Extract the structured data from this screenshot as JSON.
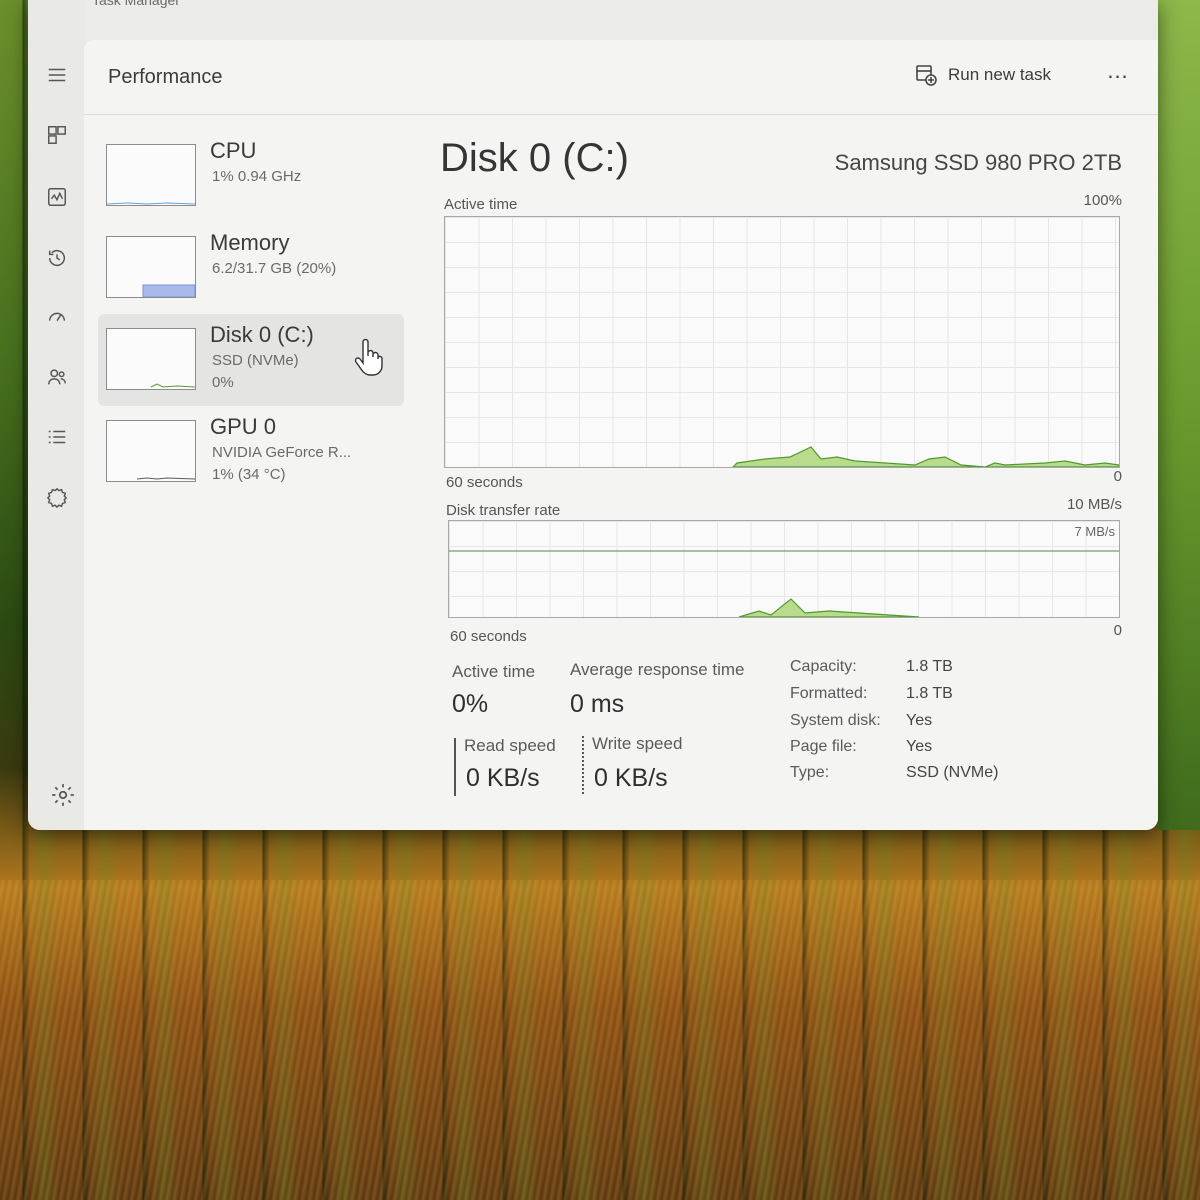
{
  "window": {
    "title": "Task Manager",
    "page_title": "Performance",
    "run_new_task": "Run new task",
    "more_options": "..."
  },
  "nav": {
    "items": [
      {
        "name": "menu-icon"
      },
      {
        "name": "processes-icon"
      },
      {
        "name": "performance-icon"
      },
      {
        "name": "app-history-icon"
      },
      {
        "name": "startup-apps-icon"
      },
      {
        "name": "users-icon"
      },
      {
        "name": "details-icon"
      },
      {
        "name": "services-icon"
      },
      {
        "name": "settings-icon"
      }
    ]
  },
  "devices": [
    {
      "name": "CPU",
      "line1": "1% 0.94 GHz",
      "line2": ""
    },
    {
      "name": "Memory",
      "line1": "6.2/31.7 GB (20%)",
      "line2": ""
    },
    {
      "name": "Disk 0 (C:)",
      "line1": "SSD (NVMe)",
      "line2": "0%"
    },
    {
      "name": "GPU 0",
      "line1": "NVIDIA GeForce R...",
      "line2": "1% (34 °C)"
    }
  ],
  "detail": {
    "title": "Disk 0 (C:)",
    "model": "Samsung SSD 980 PRO 2TB",
    "active_time_graph": {
      "label": "Active time",
      "max": "100%",
      "time_span": "60 seconds",
      "min": "0"
    },
    "transfer_graph": {
      "label": "Disk transfer rate",
      "max": "10 MB/s",
      "marker": "7 MB/s",
      "time_span": "60 seconds",
      "min": "0"
    },
    "stats": {
      "active_time_label": "Active time",
      "active_time_value": "0%",
      "avg_response_label": "Average response time",
      "avg_response_value": "0 ms",
      "read_speed_label": "Read speed",
      "read_speed_value": "0 KB/s",
      "write_speed_label": "Write speed",
      "write_speed_value": "0 KB/s"
    },
    "properties": [
      {
        "key": "Capacity:",
        "value": "1.8 TB"
      },
      {
        "key": "Formatted:",
        "value": "1.8 TB"
      },
      {
        "key": "System disk:",
        "value": "Yes"
      },
      {
        "key": "Page file:",
        "value": "Yes"
      },
      {
        "key": "Type:",
        "value": "SSD (NVMe)"
      }
    ]
  },
  "colors": {
    "graph_fill": "#b9dc8c",
    "graph_line": "#4f9a2c",
    "memory_fill": "#a9b9ea",
    "accent": "#3a74d8"
  }
}
